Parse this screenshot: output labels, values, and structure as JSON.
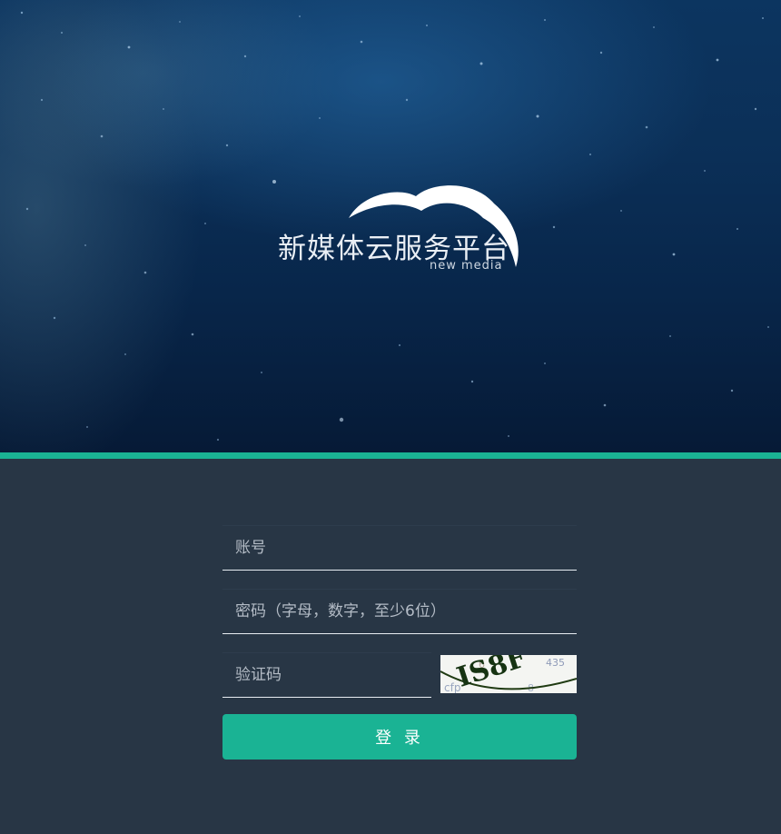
{
  "branding": {
    "title": "新媒体云服务平台",
    "subtitle": "new media"
  },
  "login_form": {
    "account_placeholder": "账号",
    "password_placeholder": "密码（字母，数字，至少6位）",
    "captcha_placeholder": "验证码",
    "captcha_text": "IS8F",
    "login_button": "登 录"
  },
  "colors": {
    "accent": "#1ab394",
    "form_background": "#283645",
    "hero_background": "#0b2f57"
  }
}
